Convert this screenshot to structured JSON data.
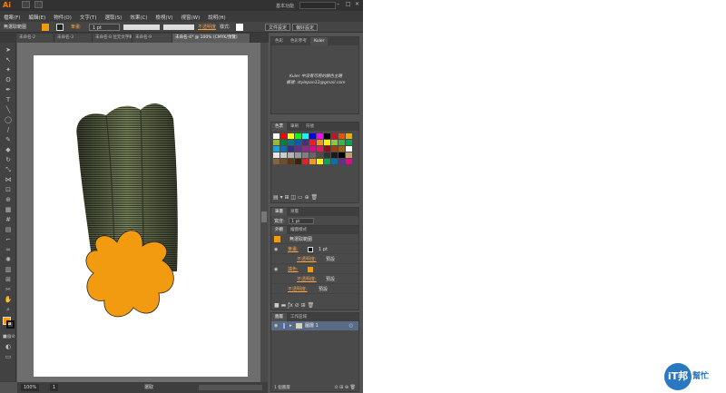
{
  "app": {
    "logo": "Ai",
    "workspace_label": "基本功能",
    "menus": [
      "檔案(F)",
      "編輯(E)",
      "物件(O)",
      "文字(T)",
      "選取(S)",
      "效果(C)",
      "檢視(V)",
      "視窗(W)",
      "說明(H)"
    ]
  },
  "control_bar": {
    "selection_label": "無選取範圍",
    "stroke_label": "筆畫:",
    "stroke_weight": "1 pt",
    "opacity_label": "不透明度",
    "style_label": "樣式:",
    "doc_setup_button": "文件設定",
    "preferences_button": "偏好設定"
  },
  "doc_tabs": [
    "未命名-2",
    "未命名-3",
    "未命名-8 位元文字轉印",
    "未命名-9",
    "未命名-4* @ 100% (CMYK/預覽)"
  ],
  "status_bar": {
    "zoom": "100%",
    "page": "1",
    "mode": "選取"
  },
  "colors": {
    "fill": "#f29a10",
    "accent": "#ff7c00",
    "layer_highlight": "#5a6b87"
  },
  "kuler_panel": {
    "tabs": [
      "色彩",
      "色彩參考",
      "Kuler"
    ],
    "message_line1": "Kuler 中沒有可用的顏色主題",
    "message_line2": "帳號: stylepan12@gmail.com"
  },
  "swatches_panel": {
    "tabs": [
      "色票",
      "筆刷",
      "符號"
    ]
  },
  "stroke_panel": {
    "tabs": [
      "筆畫",
      "漸層"
    ],
    "weight_label": "寬度:",
    "weight_value": "1 pt"
  },
  "appearance_panel": {
    "tabs": [
      "外觀",
      "繪圖樣式"
    ],
    "title": "無選取範圍",
    "stroke_label": "筆畫:",
    "stroke_value": "1 pt",
    "opacity_label": "不透明度:",
    "opacity_value": "預設",
    "fill_label": "填色:",
    "fill_opacity_label": "不透明度:",
    "fill_opacity_value": "預設",
    "overall_opacity_label": "不透明度:",
    "overall_opacity_value": "預設"
  },
  "layers_panel": {
    "tabs": [
      "圖層",
      "工作區域"
    ],
    "layer_name": "圖層 1",
    "footer": "1 個圖層"
  },
  "watermark": {
    "circle_text": "iT邦",
    "text": "幫忙"
  }
}
